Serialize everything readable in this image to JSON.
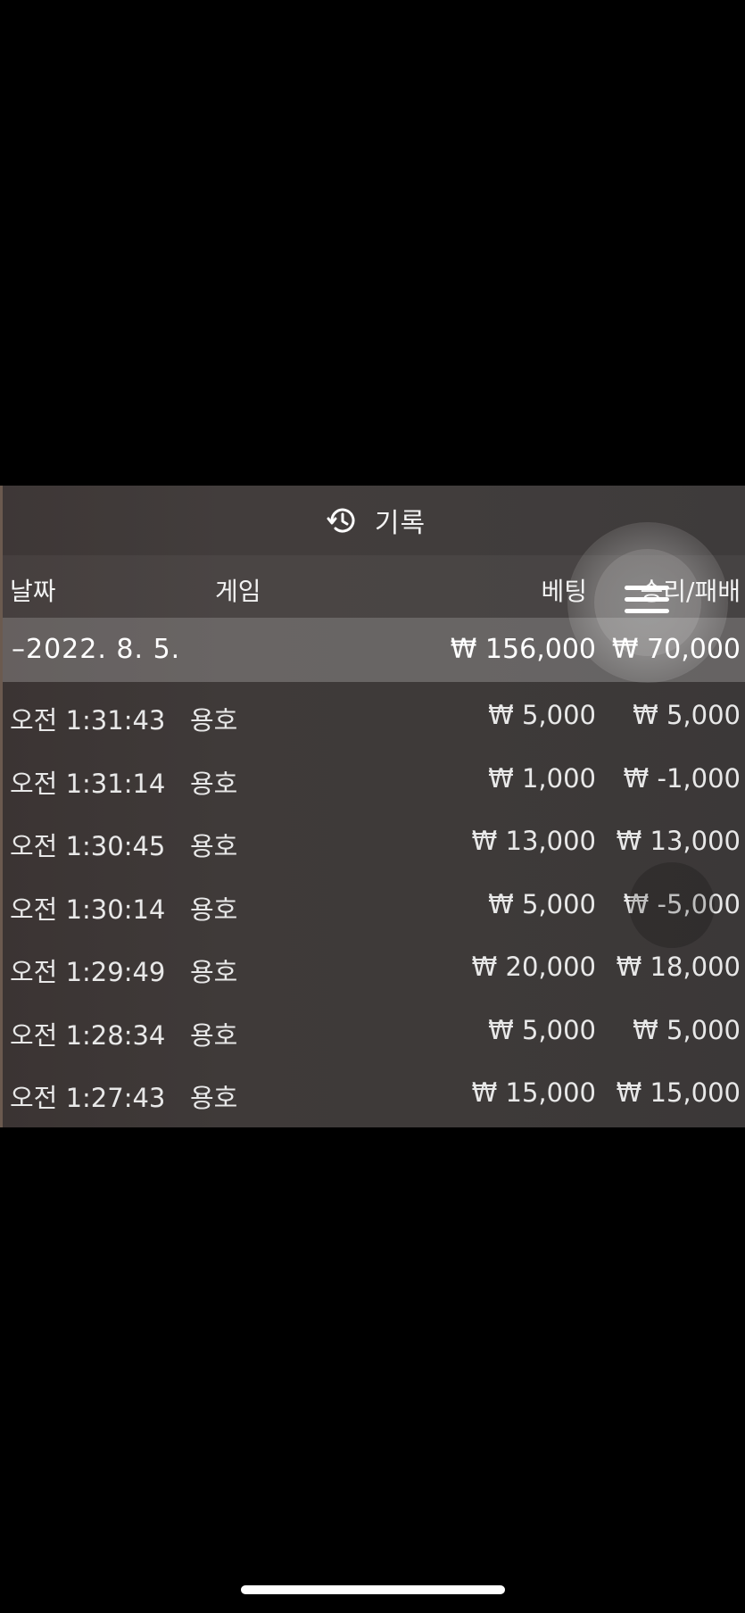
{
  "title": {
    "icon": "history-icon",
    "label": "기록"
  },
  "columns": {
    "date": "날짜",
    "game": "게임",
    "bet": "베팅",
    "win_loss": "승리/패배"
  },
  "group": {
    "toggle": "–",
    "date": "2022. 8. 5.",
    "bet_total": "₩ 156,000",
    "win_total": "₩ 70,000"
  },
  "rows": [
    {
      "time": "오전 1:31:43",
      "game": "용호",
      "bet": "₩ 5,000",
      "win": "₩ 5,000"
    },
    {
      "time": "오전 1:31:14",
      "game": "용호",
      "bet": "₩ 1,000",
      "win": "₩ -1,000"
    },
    {
      "time": "오전 1:30:45",
      "game": "용호",
      "bet": "₩ 13,000",
      "win": "₩ 13,000"
    },
    {
      "time": "오전 1:30:14",
      "game": "용호",
      "bet": "₩ 5,000",
      "win": "₩ -5,000"
    },
    {
      "time": "오전 1:29:49",
      "game": "용호",
      "bet": "₩ 20,000",
      "win": "₩ 18,000"
    },
    {
      "time": "오전 1:28:34",
      "game": "용호",
      "bet": "₩ 5,000",
      "win": "₩ 5,000"
    },
    {
      "time": "오전 1:27:43",
      "game": "용호",
      "bet": "₩ 15,000",
      "win": "₩ 15,000"
    }
  ],
  "overlay": {
    "menu_icon": "menu-icon"
  },
  "colors": {
    "panel": "#3e3a39",
    "header": "#4a4645",
    "group": "#6a6665",
    "text": "#ffffff"
  }
}
